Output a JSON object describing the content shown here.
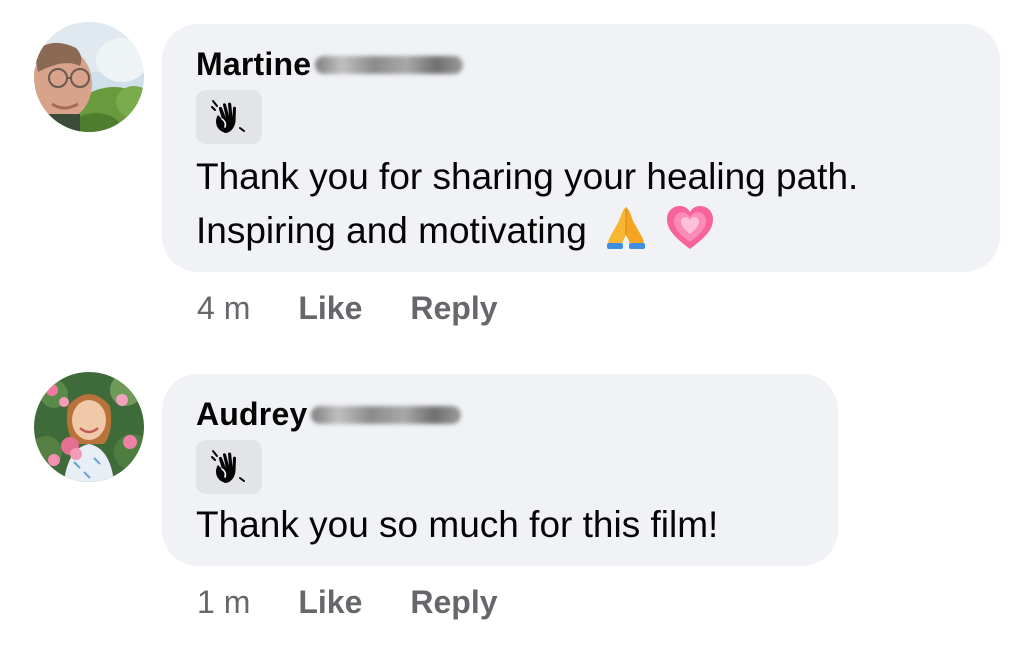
{
  "comments": [
    {
      "author_first_name": "Martine",
      "author_last_name_redacted": true,
      "badge_icon": "waving-hand-icon",
      "text_line1": "Thank you for sharing your healing path.",
      "text_line2": "Inspiring and motivating",
      "emojis": [
        "folded-hands-emoji",
        "growing-heart-emoji"
      ],
      "timestamp": "4 m",
      "like_label": "Like",
      "reply_label": "Reply"
    },
    {
      "author_first_name": "Audrey",
      "author_last_name_redacted": true,
      "badge_icon": "waving-hand-icon",
      "text_line1": "Thank you so much for this film!",
      "timestamp": "1 m",
      "like_label": "Like",
      "reply_label": "Reply"
    }
  ],
  "colors": {
    "bubble_background": "#f0f2f5",
    "primary_text": "#050505",
    "secondary_text": "#65676b",
    "badge_background": "#e2e4e8"
  }
}
